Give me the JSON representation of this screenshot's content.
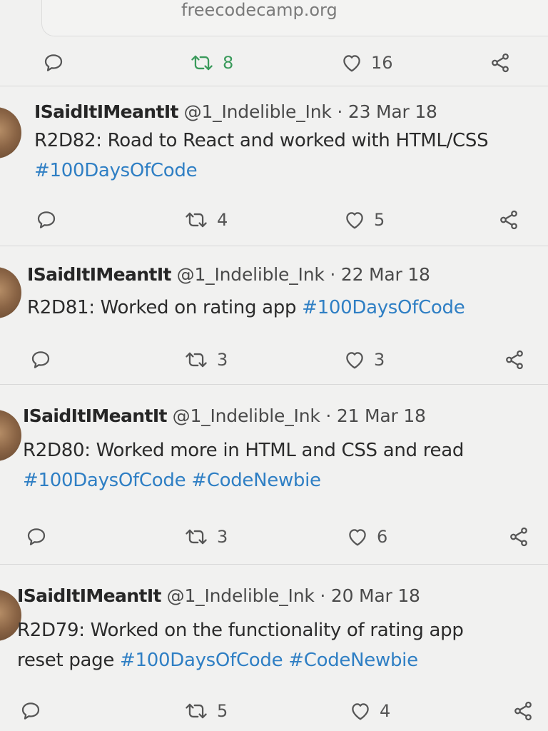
{
  "link_card": {
    "domain": "freecodecamp.org"
  },
  "top_actions": {
    "retweets": "8",
    "likes": "16"
  },
  "tweets": [
    {
      "name": "ISaidItIMeantIt",
      "handle": "@1_Indelible_Ink",
      "date": "· 23 Mar 18",
      "line1": "R2D82: Road to React and worked with HTML/CSS",
      "line2_tags": [
        "#100DaysOfCode"
      ],
      "retweets": "4",
      "likes": "5"
    },
    {
      "name": "ISaidItIMeantIt",
      "handle": "@1_Indelible_Ink",
      "date": "· 22 Mar 18",
      "line1": "R2D81: Worked on rating app ",
      "line1_tag": "#100DaysOfCode",
      "retweets": "3",
      "likes": "3"
    },
    {
      "name": "ISaidItIMeantIt",
      "handle": "@1_Indelible_Ink",
      "date": "· 21 Mar 18",
      "line1": "R2D80:  Worked more in HTML and CSS and read",
      "line2_tags": [
        "#100DaysOfCode",
        "#CodeNewbie"
      ],
      "retweets": "3",
      "likes": "6"
    },
    {
      "name": "ISaidItIMeantIt",
      "handle": "@1_Indelible_Ink",
      "date": "· 20 Mar 18",
      "line1": "R2D79: Worked on the functionality of rating app",
      "line2_prefix": "reset page ",
      "line2_tags": [
        "#100DaysOfCode",
        "#CodeNewbie"
      ],
      "retweets": "5",
      "likes": "4"
    }
  ],
  "icons": {
    "reply": "reply-icon",
    "retweet": "retweet-icon",
    "like": "heart-icon",
    "share": "share-icon"
  },
  "colors": {
    "hashtag": "#2f7fc4",
    "retweeted": "#3a9a5b",
    "background": "#f1f1f0"
  }
}
